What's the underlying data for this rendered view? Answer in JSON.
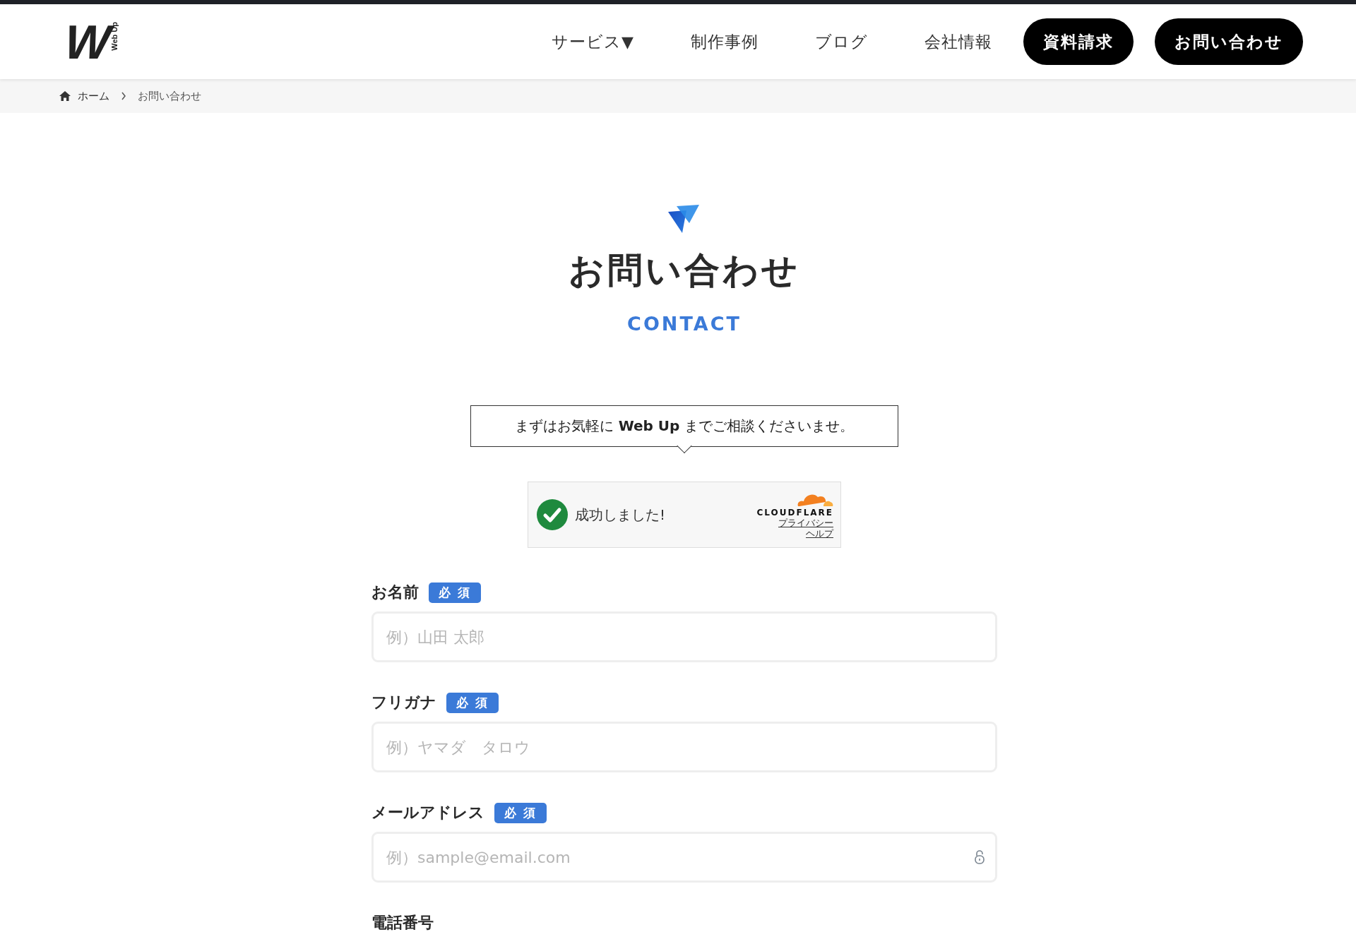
{
  "header": {
    "logo": {
      "mark": "W",
      "text": "Web Up"
    },
    "nav": [
      {
        "label": "サービス",
        "caret": "▼"
      },
      {
        "label": "制作事例"
      },
      {
        "label": "ブログ"
      },
      {
        "label": "会社情報"
      }
    ],
    "buttons": [
      "資料請求",
      "お問い合わせ"
    ]
  },
  "breadcrumb": [
    "ホーム",
    "お問い合わせ"
  ],
  "hero": {
    "title": "お問い合わせ",
    "subtitle": "CONTACT"
  },
  "intro": "まずはお気軽に **Web Up** までご相談くださいませ。",
  "captcha": {
    "status": "成功しました!",
    "success": true,
    "brand": "CLOUDFLARE",
    "links": [
      "プライバシー",
      "ヘルプ"
    ]
  },
  "form": {
    "fields": [
      {
        "label": "お名前",
        "required": true,
        "badge": "必 須",
        "kind": "text",
        "placeholder": "例）山田 太郎"
      },
      {
        "label": "フリガナ",
        "required": true,
        "badge": "必 須",
        "kind": "text",
        "placeholder": "例）ヤマダ　タロウ"
      },
      {
        "label": "メールアドレス",
        "required": true,
        "badge": "必 須",
        "kind": "email",
        "placeholder": "例）sample@email.com"
      },
      {
        "label": "電話番号",
        "required": false
      }
    ]
  }
}
